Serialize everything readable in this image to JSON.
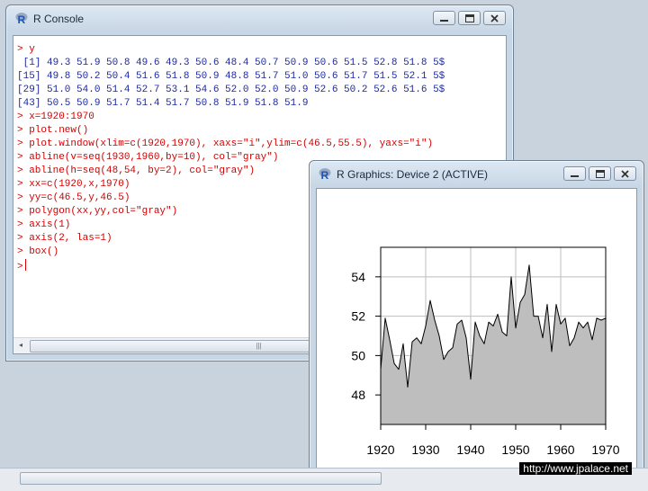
{
  "console": {
    "title": "R Console",
    "lines": [
      {
        "kind": "in",
        "text": "> y"
      },
      {
        "kind": "out",
        "text": " [1] 49.3 51.9 50.8 49.6 49.3 50.6 48.4 50.7 50.9 50.6 51.5 52.8 51.8 5$"
      },
      {
        "kind": "out",
        "text": "[15] 49.8 50.2 50.4 51.6 51.8 50.9 48.8 51.7 51.0 50.6 51.7 51.5 52.1 5$"
      },
      {
        "kind": "out",
        "text": "[29] 51.0 54.0 51.4 52.7 53.1 54.6 52.0 52.0 50.9 52.6 50.2 52.6 51.6 5$"
      },
      {
        "kind": "out",
        "text": "[43] 50.5 50.9 51.7 51.4 51.7 50.8 51.9 51.8 51.9"
      },
      {
        "kind": "in",
        "text": "> x=1920:1970"
      },
      {
        "kind": "in",
        "text": "> plot.new()"
      },
      {
        "kind": "in",
        "text": "> plot.window(xlim=c(1920,1970), xaxs=\"i\",ylim=c(46.5,55.5), yaxs=\"i\")"
      },
      {
        "kind": "in",
        "text": "> abline(v=seq(1930,1960,by=10), col=\"gray\")"
      },
      {
        "kind": "in",
        "text": "> abline(h=seq(48,54, by=2), col=\"gray\")"
      },
      {
        "kind": "in",
        "text": "> xx=c(1920,x,1970)"
      },
      {
        "kind": "in",
        "text": "> yy=c(46.5,y,46.5)"
      },
      {
        "kind": "in",
        "text": "> polygon(xx,yy,col=\"gray\")"
      },
      {
        "kind": "in",
        "text": "> axis(1)"
      },
      {
        "kind": "in",
        "text": "> axis(2, las=1)"
      },
      {
        "kind": "in",
        "text": "> box()"
      }
    ],
    "prompt": ">"
  },
  "graphics": {
    "title": "R Graphics: Device 2 (ACTIVE)"
  },
  "watermark": "http://www.jpalace.net",
  "chart_data": {
    "type": "area",
    "x_start": 1920,
    "x_end": 1970,
    "values": [
      49.3,
      51.9,
      50.8,
      49.6,
      49.3,
      50.6,
      48.4,
      50.7,
      50.9,
      50.6,
      51.5,
      52.8,
      51.8,
      51.0,
      49.8,
      50.2,
      50.4,
      51.6,
      51.8,
      50.9,
      48.8,
      51.7,
      51.0,
      50.6,
      51.7,
      51.5,
      52.1,
      51.2,
      51.0,
      54.0,
      51.4,
      52.7,
      53.1,
      54.6,
      52.0,
      52.0,
      50.9,
      52.6,
      50.2,
      52.6,
      51.6,
      51.9,
      50.5,
      50.9,
      51.7,
      51.4,
      51.7,
      50.8,
      51.9,
      51.8,
      51.9
    ],
    "xlim": [
      1920,
      1970
    ],
    "ylim": [
      46.5,
      55.5
    ],
    "x_ticks": [
      1920,
      1930,
      1940,
      1950,
      1960,
      1970
    ],
    "y_ticks": [
      48,
      50,
      52,
      54
    ],
    "v_grid": [
      1930,
      1940,
      1950,
      1960
    ],
    "h_grid": [
      48,
      50,
      52,
      54
    ],
    "fill": "#bebebe",
    "grid_color": "#bebebe"
  }
}
